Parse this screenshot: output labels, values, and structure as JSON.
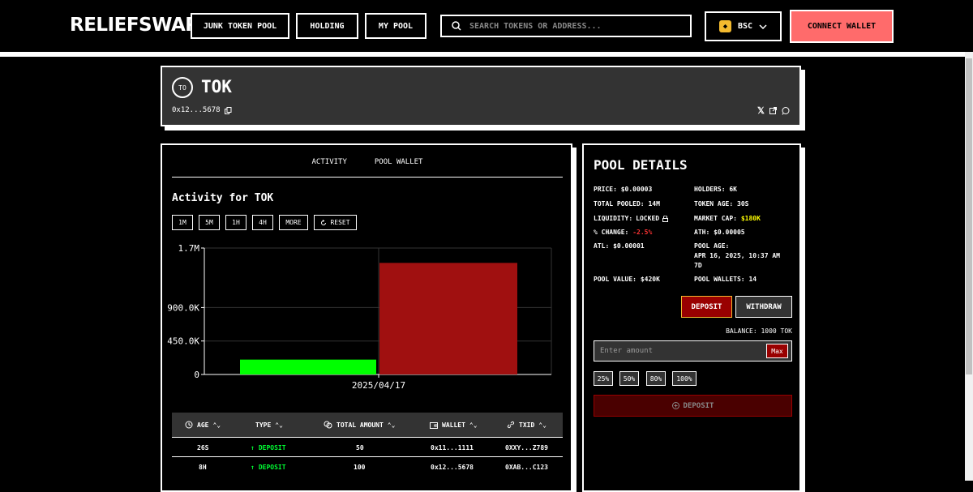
{
  "header": {
    "logo": "RELIEFSWAP",
    "nav": [
      "JUNK TOKEN POOL",
      "HOLDING",
      "MY POOL"
    ],
    "search_placeholder": "SEARCH TOKENS OR ADDRESS...",
    "chain": "BSC",
    "connect": "CONNECT WALLET"
  },
  "token": {
    "icon_text": "TO",
    "name": "TOK",
    "address": "0x12...5678"
  },
  "activity": {
    "tabs": [
      "ACTIVITY",
      "POOL WALLET"
    ],
    "title": "Activity for TOK",
    "timeframes": [
      "1M",
      "5M",
      "1H",
      "4H",
      "MORE"
    ],
    "reset": "RESET"
  },
  "chart_data": {
    "type": "bar",
    "categories": [
      "2025/04/17"
    ],
    "y_ticks": [
      "0",
      "450.0K",
      "900.0K",
      "1.7M"
    ],
    "y_tick_values": [
      0,
      450000,
      900000,
      1700000
    ],
    "ylim": [
      0,
      1700000
    ],
    "series": [
      {
        "values": [
          200000
        ],
        "color": "#00ff00"
      },
      {
        "values": [
          1500000
        ],
        "color": "#a01010"
      }
    ]
  },
  "table": {
    "headers": [
      "AGE",
      "TYPE",
      "TOTAL AMOUNT",
      "WALLET",
      "TXID"
    ],
    "rows": [
      {
        "age": "26S",
        "type": "DEPOSIT",
        "amount": "50",
        "wallet": "0x11...1111",
        "txid": "0XXY...Z789"
      },
      {
        "age": "8H",
        "type": "DEPOSIT",
        "amount": "100",
        "wallet": "0x12...5678",
        "txid": "0XAB...C123"
      }
    ]
  },
  "pool": {
    "title": "POOL DETAILS",
    "price_label": "PRICE:",
    "price": "$0.00003",
    "holders_label": "HOLDERS:",
    "holders": "6K",
    "pooled_label": "TOTAL POOLED:",
    "pooled": "14M",
    "age_label": "TOKEN AGE:",
    "age": "30S",
    "liq_label": "LIQUIDITY:",
    "liq": "LOCKED",
    "mcap_label": "MARKET CAP:",
    "mcap": "$180K",
    "change_label": "% CHANGE:",
    "change": "-2.5%",
    "ath_label": "ATH:",
    "ath": "$0.00005",
    "atl_label": "ATL:",
    "atl": "$0.00001",
    "pool_age_label": "POOL AGE:",
    "pool_age": "APR 16, 2025, 10:37 AM",
    "pool_age_rel": "7D",
    "value_label": "POOL VALUE:",
    "value": "$420K",
    "wallets_label": "POOL WALLETS:",
    "wallets": "14",
    "deposit_tab": "DEPOSIT",
    "withdraw_tab": "WITHDRAW",
    "balance": "BALANCE: 1000 TOK",
    "amount_placeholder": "Enter amount",
    "max": "Max",
    "percents": [
      "25%",
      "50%",
      "80%",
      "100%"
    ],
    "deposit_button": "DEPOSIT"
  }
}
